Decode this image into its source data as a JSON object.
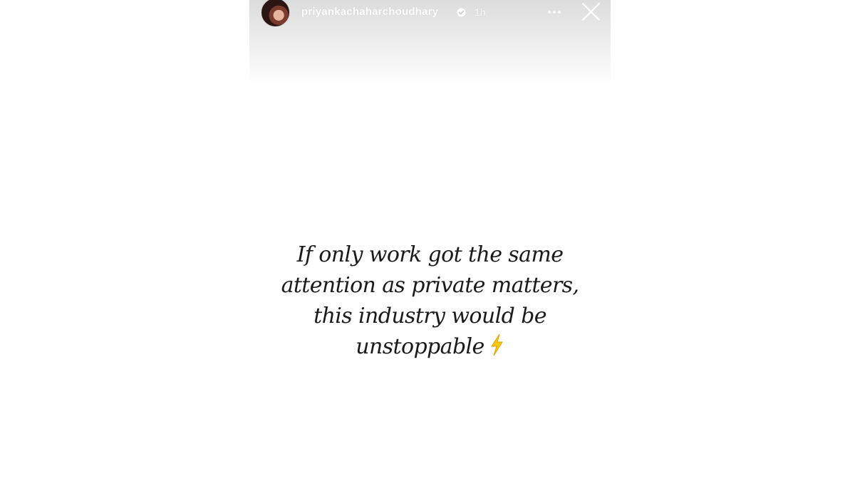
{
  "story": {
    "username": "priyankachaharchoudhary",
    "timestamp": "1h",
    "verified_icon": "verified-badge-icon",
    "more_icon": "more-horizontal-icon",
    "close_icon": "close-icon",
    "text_lines": [
      "If only work got the same",
      "attention as private matters,",
      "this industry would be",
      "unstoppable"
    ],
    "emoji_icon": "lightning-bolt-icon",
    "colors": {
      "text": "#1a1a1a",
      "header_overlay": "#dcdcdc",
      "bolt": "#f5c518"
    }
  }
}
